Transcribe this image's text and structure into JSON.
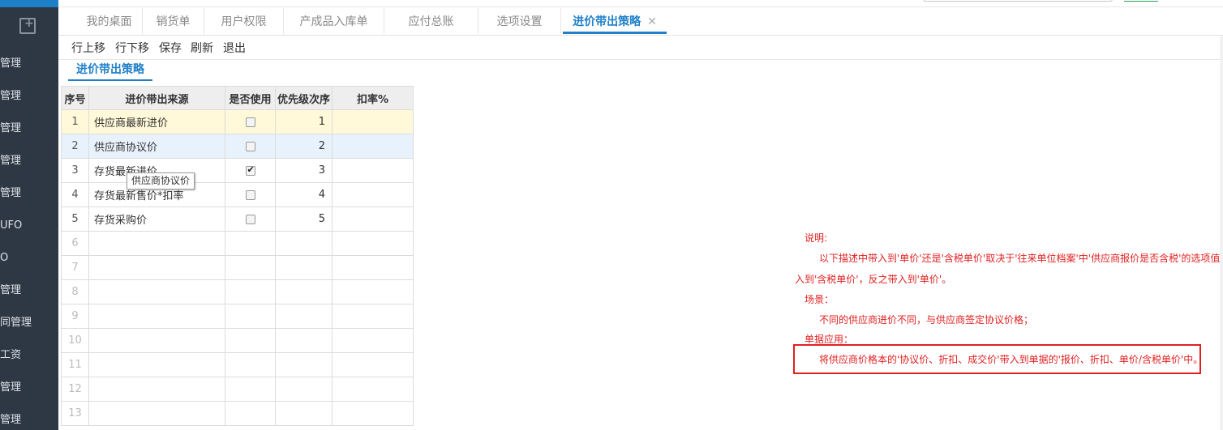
{
  "sidebar": {
    "items": [
      "管理",
      "管理",
      "管理",
      "管理",
      "管理",
      "UFO",
      "O",
      "管理",
      "同管理",
      "工资",
      "管理",
      "管理"
    ]
  },
  "tabs": [
    {
      "label": "我的桌面",
      "active": false
    },
    {
      "label": "销货单",
      "active": false
    },
    {
      "label": "用户权限",
      "active": false
    },
    {
      "label": "产成品入库单",
      "active": false
    },
    {
      "label": "应付总账",
      "active": false
    },
    {
      "label": "选项设置",
      "active": false
    },
    {
      "label": "进价带出策略",
      "active": true
    }
  ],
  "toolbar": {
    "move_up": "行上移",
    "move_down": "行下移",
    "save": "保存",
    "refresh": "刷新",
    "exit": "退出"
  },
  "subtab": {
    "label": "进价带出策略"
  },
  "grid": {
    "headers": [
      "序号",
      "进价带出来源",
      "是否使用",
      "优先级次序",
      "扣率%"
    ],
    "rows": [
      {
        "no": "1",
        "source": "供应商最新进价",
        "used": false,
        "priority": "1",
        "discount": ""
      },
      {
        "no": "2",
        "source": "供应商协议价",
        "used": false,
        "priority": "2",
        "discount": ""
      },
      {
        "no": "3",
        "source": "存货最新进价",
        "used": true,
        "priority": "3",
        "discount": ""
      },
      {
        "no": "4",
        "source": "存货最新售价*扣率",
        "used": false,
        "priority": "4",
        "discount": ""
      },
      {
        "no": "5",
        "source": "存货采购价",
        "used": false,
        "priority": "5",
        "discount": ""
      },
      {
        "no": "6"
      },
      {
        "no": "7"
      },
      {
        "no": "8"
      },
      {
        "no": "9"
      },
      {
        "no": "10"
      },
      {
        "no": "11"
      },
      {
        "no": "12"
      },
      {
        "no": "13"
      }
    ]
  },
  "tooltip": {
    "text": "供应商协议价"
  },
  "notes": {
    "title": "说明:",
    "line1": "以下描述中带入到'单价'还是'含税单价'取决于'往来单位档案'中'供应商报价是否含税'的选项值，",
    "line2": "入到'含税单价'，反之带入到'单价'。",
    "scene_title": "场景：",
    "scene_text": "不同的供应商进价不同，与供应商签定协议价格；",
    "apply_title": "单据应用：",
    "apply_text": "将供应商价格本的'协议价、折扣、成交价'带入到单据的'报价、折扣、单价/含税单价'中。"
  },
  "colors": {
    "accent": "#1f80c8",
    "sidebar_bg": "#2e3845",
    "note_red": "#e02020",
    "selected_row": "#fff8d9",
    "hover_row": "#e8f2fc"
  }
}
